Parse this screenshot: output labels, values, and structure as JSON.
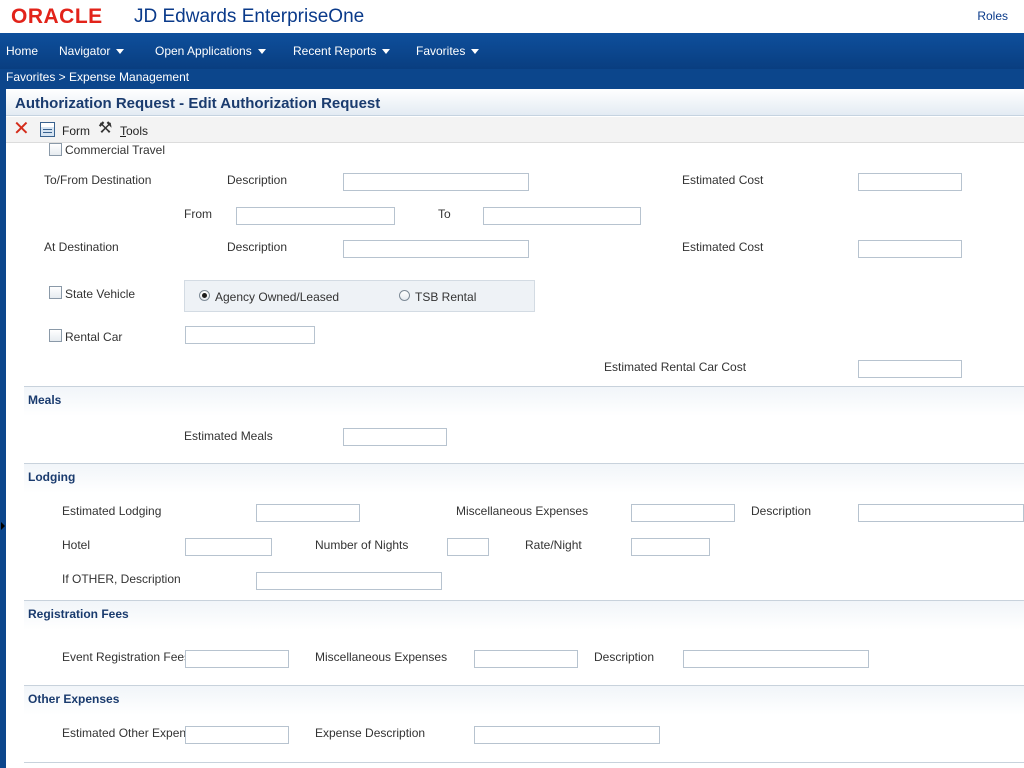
{
  "header": {
    "logo_text": "ORACLE",
    "product": "JD Edwards EnterpriseOne",
    "roles": "Roles"
  },
  "nav": {
    "items": [
      {
        "label": "Home",
        "dropdown": false
      },
      {
        "label": "Navigator",
        "dropdown": true
      },
      {
        "label": "Open Applications",
        "dropdown": true
      },
      {
        "label": "Recent Reports",
        "dropdown": true
      },
      {
        "label": "Favorites",
        "dropdown": true
      }
    ]
  },
  "breadcrumb": "Favorites > Expense Management",
  "title": "Authorization Request - Edit Authorization Request",
  "toolbar": {
    "form_label": "Form",
    "tools_label_first": "T",
    "tools_label_rest": "ools"
  },
  "travel": {
    "commercial_travel": "Commercial Travel",
    "to_from_destination": "To/From Destination",
    "description": "Description",
    "estimated_cost": "Estimated Cost",
    "from": "From",
    "to": "To",
    "at_destination": "At Destination",
    "state_vehicle": "State Vehicle",
    "agency_owned": "Agency Owned/Leased",
    "tsb_rental": "TSB Rental",
    "rental_car": "Rental Car",
    "estimated_rental_car_cost": "Estimated Rental Car Cost"
  },
  "meals": {
    "header": "Meals",
    "estimated_meals": "Estimated Meals"
  },
  "lodging": {
    "header": "Lodging",
    "estimated_lodging": "Estimated Lodging",
    "misc_expenses": "Miscellaneous Expenses",
    "description": "Description",
    "hotel": "Hotel",
    "number_of_nights": "Number of Nights",
    "rate_night": "Rate/Night",
    "if_other_description": "If OTHER, Description"
  },
  "registration": {
    "header": "Registration Fees",
    "event_registration_fees": "Event Registration Fees",
    "misc_expenses": "Miscellaneous Expenses",
    "description": "Description"
  },
  "other": {
    "header": "Other Expenses",
    "estimated_other_expenses": "Estimated Other Expens",
    "expense_description": "Expense Description"
  },
  "colors": {
    "nav_blue": "#0c468c",
    "title_text": "#1a3b6e",
    "oracle_red": "#e2231a"
  }
}
